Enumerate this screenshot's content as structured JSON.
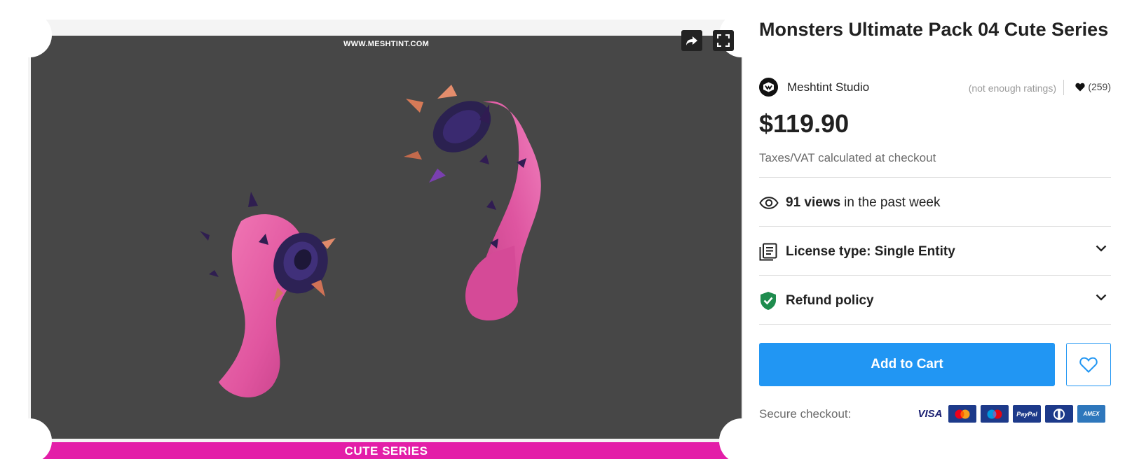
{
  "viewer": {
    "watermark": "WWW.MESHTINT.COM",
    "banner": "CUTE SERIES"
  },
  "product": {
    "title": "Monsters Ultimate Pack 04 Cute Series",
    "publisher": "Meshtint Studio",
    "ratings_text": "(not enough ratings)",
    "favorites_count": "(259)",
    "price": "$119.90",
    "tax_note": "Taxes/VAT calculated at checkout",
    "views_count": "91 views",
    "views_suffix": "in the past week",
    "license_label": "License type: Single Entity",
    "refund_label": "Refund policy",
    "add_to_cart": "Add to Cart",
    "secure_checkout": "Secure checkout:"
  },
  "payments": {
    "visa": "VISA",
    "paypal": "PayPal",
    "amex": "AMEX"
  },
  "colors": {
    "accent": "#2196f3",
    "banner": "#e31ea8",
    "stage_bg": "#474747",
    "refund_shield": "#1e8c4e"
  },
  "icons": [
    "share-icon",
    "fullscreen-icon",
    "publisher-logo-icon",
    "heart-icon",
    "eye-icon",
    "license-icon",
    "shield-check-icon",
    "chevron-down-icon",
    "wishlist-heart-icon"
  ]
}
